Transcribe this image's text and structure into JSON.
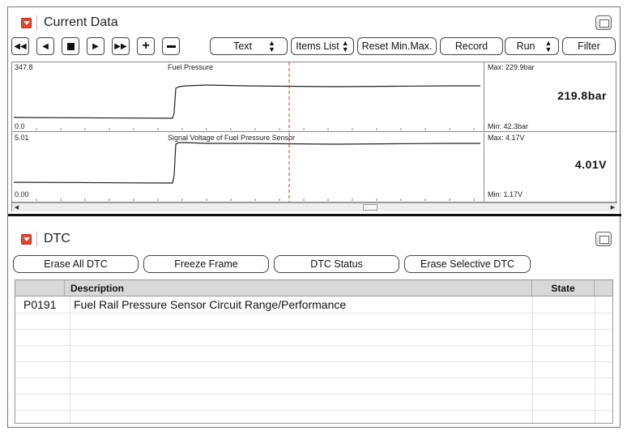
{
  "current_data": {
    "title": "Current Data",
    "toolbar": {
      "first_icon": "rewind-icon",
      "prev_icon": "step-back-icon",
      "stop_icon": "stop-icon",
      "play_icon": "play-icon",
      "ff_icon": "fast-forward-icon",
      "plus_icon": "plus-icon",
      "minus_icon": "minus-icon",
      "view_select": "Text",
      "items_list": "Items List",
      "reset": "Reset Min.Max.",
      "record": "Record",
      "run_select": "Run",
      "filter": "Filter"
    },
    "graphs": [
      {
        "name": "Fuel Pressure",
        "top_scale": "347.8",
        "bottom_scale": "0.0",
        "max": "Max: 229.9bar",
        "min": "Min:  42.3bar",
        "current": "219.8bar"
      },
      {
        "name": "Signal Voltage of Fuel Pressure Sensor",
        "top_scale": "5.01",
        "bottom_scale": "0.00",
        "max": "Max:  4.17V",
        "min": "Min:  1.17V",
        "current": "4.01V"
      }
    ]
  },
  "dtc": {
    "title": "DTC",
    "buttons": {
      "erase_all": "Erase All DTC",
      "freeze": "Freeze Frame",
      "status": "DTC Status",
      "erase_selective": "Erase Selective DTC"
    },
    "columns": {
      "code": "",
      "description": "Description",
      "state": "State"
    },
    "rows": [
      {
        "code": "P0191",
        "description": "Fuel Rail Pressure Sensor Circuit Range/Performance",
        "state": ""
      }
    ]
  },
  "colors": {
    "collapse_icon": "#e8412c",
    "cursor_line": "#d9342b"
  }
}
